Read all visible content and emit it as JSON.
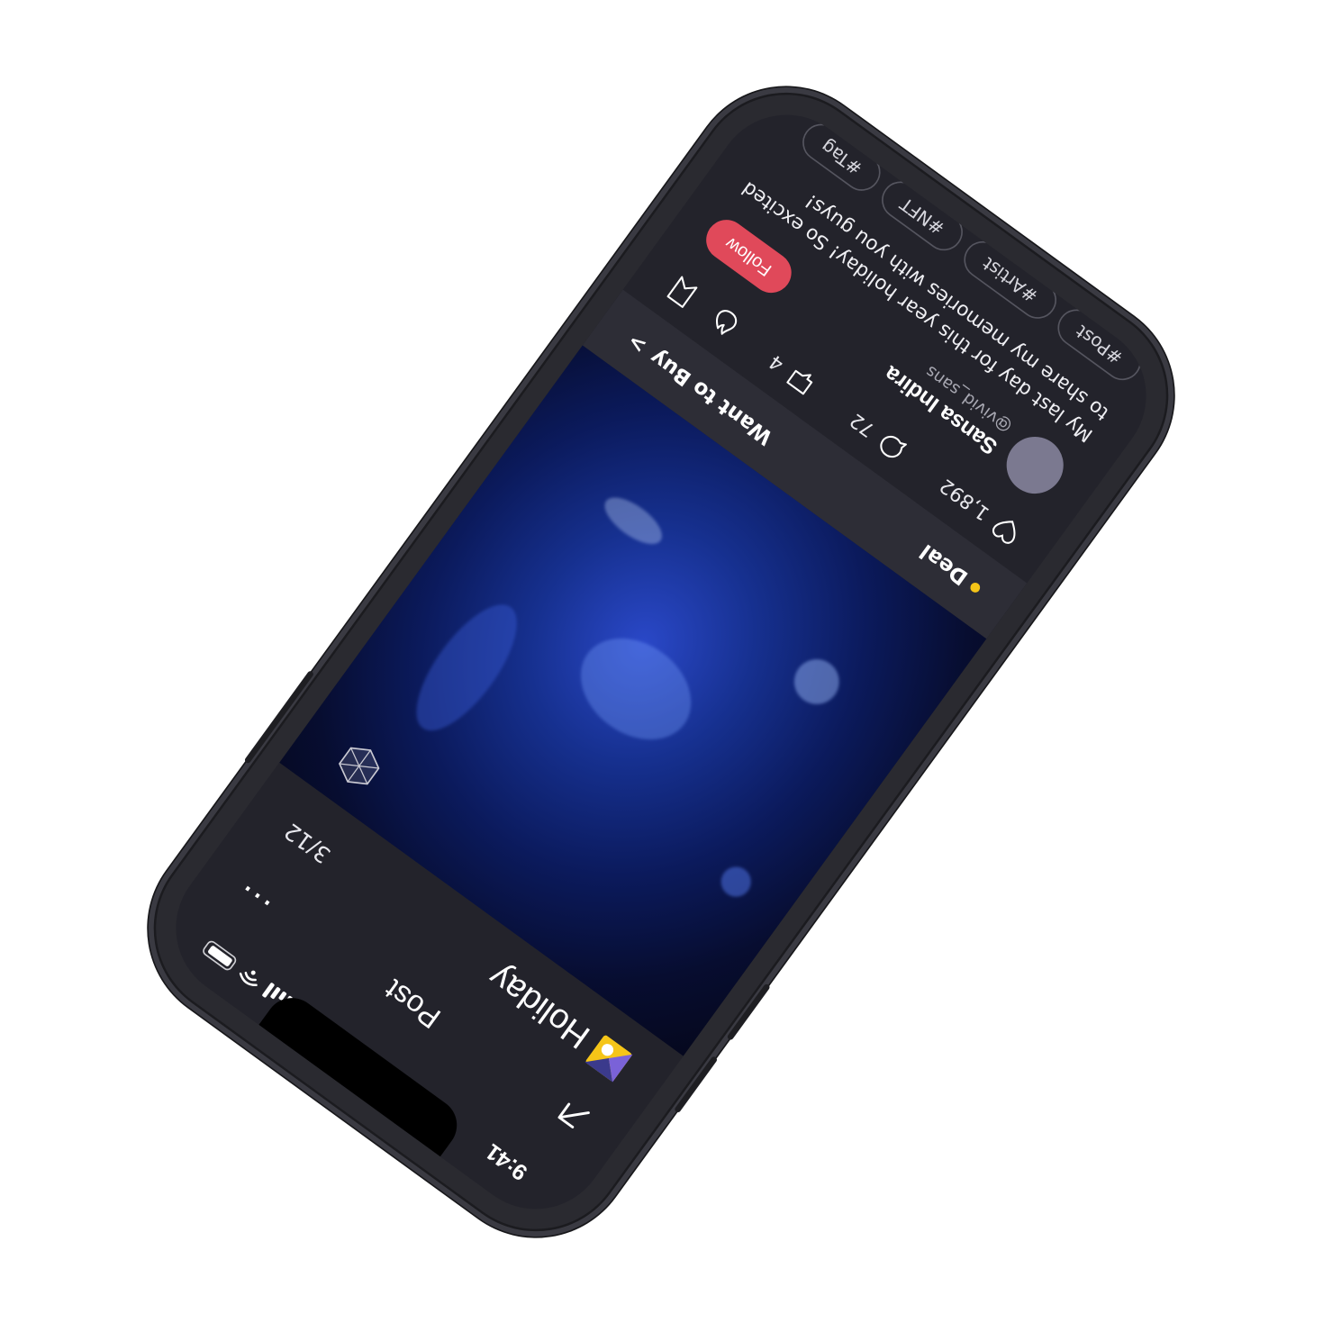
{
  "status_bar": {
    "time": "9:41"
  },
  "nav": {
    "title": "Post",
    "back_icon": "arrow-up-right-icon",
    "more_icon": "more-dots-icon",
    "more_glyph": "···"
  },
  "album": {
    "title": "Holiday",
    "badge_icon": "album-badge-icon",
    "counter": "3/12"
  },
  "hero": {
    "overlay_icon": "hexagon-icon"
  },
  "cta": {
    "deal_label": "Deal",
    "deal_dot_color": "#f5c518",
    "want_to_buy_label": "Want to Buy",
    "want_to_buy_chevron": ">"
  },
  "stats": {
    "likes": "1,892",
    "comments": "72",
    "shares": "4"
  },
  "author": {
    "name": "Sansa Indira",
    "handle": "@vivid_sans"
  },
  "follow": {
    "label": "Follow",
    "color": "#e0495a"
  },
  "caption": "My last day for this year holiday! So excited to share my memories with you guys!",
  "tags": [
    "#Post",
    "#Artist",
    "#NFT",
    "#Tag"
  ]
}
